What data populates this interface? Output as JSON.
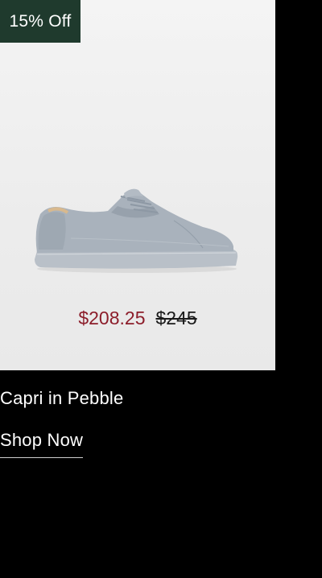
{
  "product": {
    "badge": "15% Off",
    "sale_price": "$208.25",
    "original_price": "$245",
    "name": "Capri in Pebble",
    "cta_label": "Shop Now",
    "image_icon": "sneaker-image"
  },
  "colors": {
    "background": "#000000",
    "badge_bg": "#1f3a2d",
    "sale_price": "#8c1d2a",
    "shoe": "#a8b1bb"
  }
}
